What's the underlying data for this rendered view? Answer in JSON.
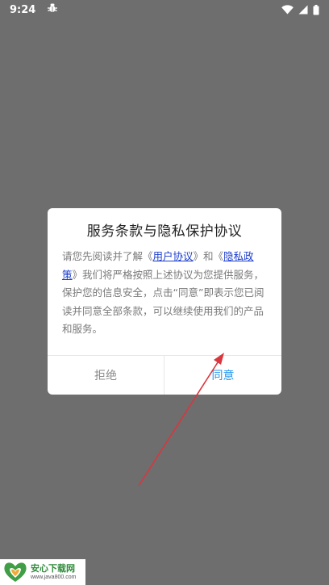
{
  "status_bar": {
    "time": "9:24",
    "notification_icon": "bug-icon",
    "wifi_icon": "wifi-icon",
    "signal_icon": "cellular-signal-icon",
    "battery_icon": "battery-icon"
  },
  "dialog": {
    "title": "服务条款与隐私保护协议",
    "body": {
      "part1": "请您先阅读并了解《",
      "link_user_agreement": "用户协议",
      "part2": "》和《",
      "link_privacy_policy": "隐私政策",
      "part3": "》我们将严格按照上述协议为您提供服务，保护您的信息安全，点击“同意”即表示您已阅读并同意全部条款，可以继续使用我们的产品和服务。"
    },
    "reject_label": "拒绝",
    "agree_label": "同意"
  },
  "annotation": {
    "arrow_color": "#d9363e"
  },
  "watermark": {
    "title": "安心下载网",
    "url": "www.java800.com",
    "logo_text": "安心"
  },
  "colors": {
    "overlay": "#6e6e6e",
    "link": "#1a3ccf",
    "agree": "#2196f3"
  }
}
